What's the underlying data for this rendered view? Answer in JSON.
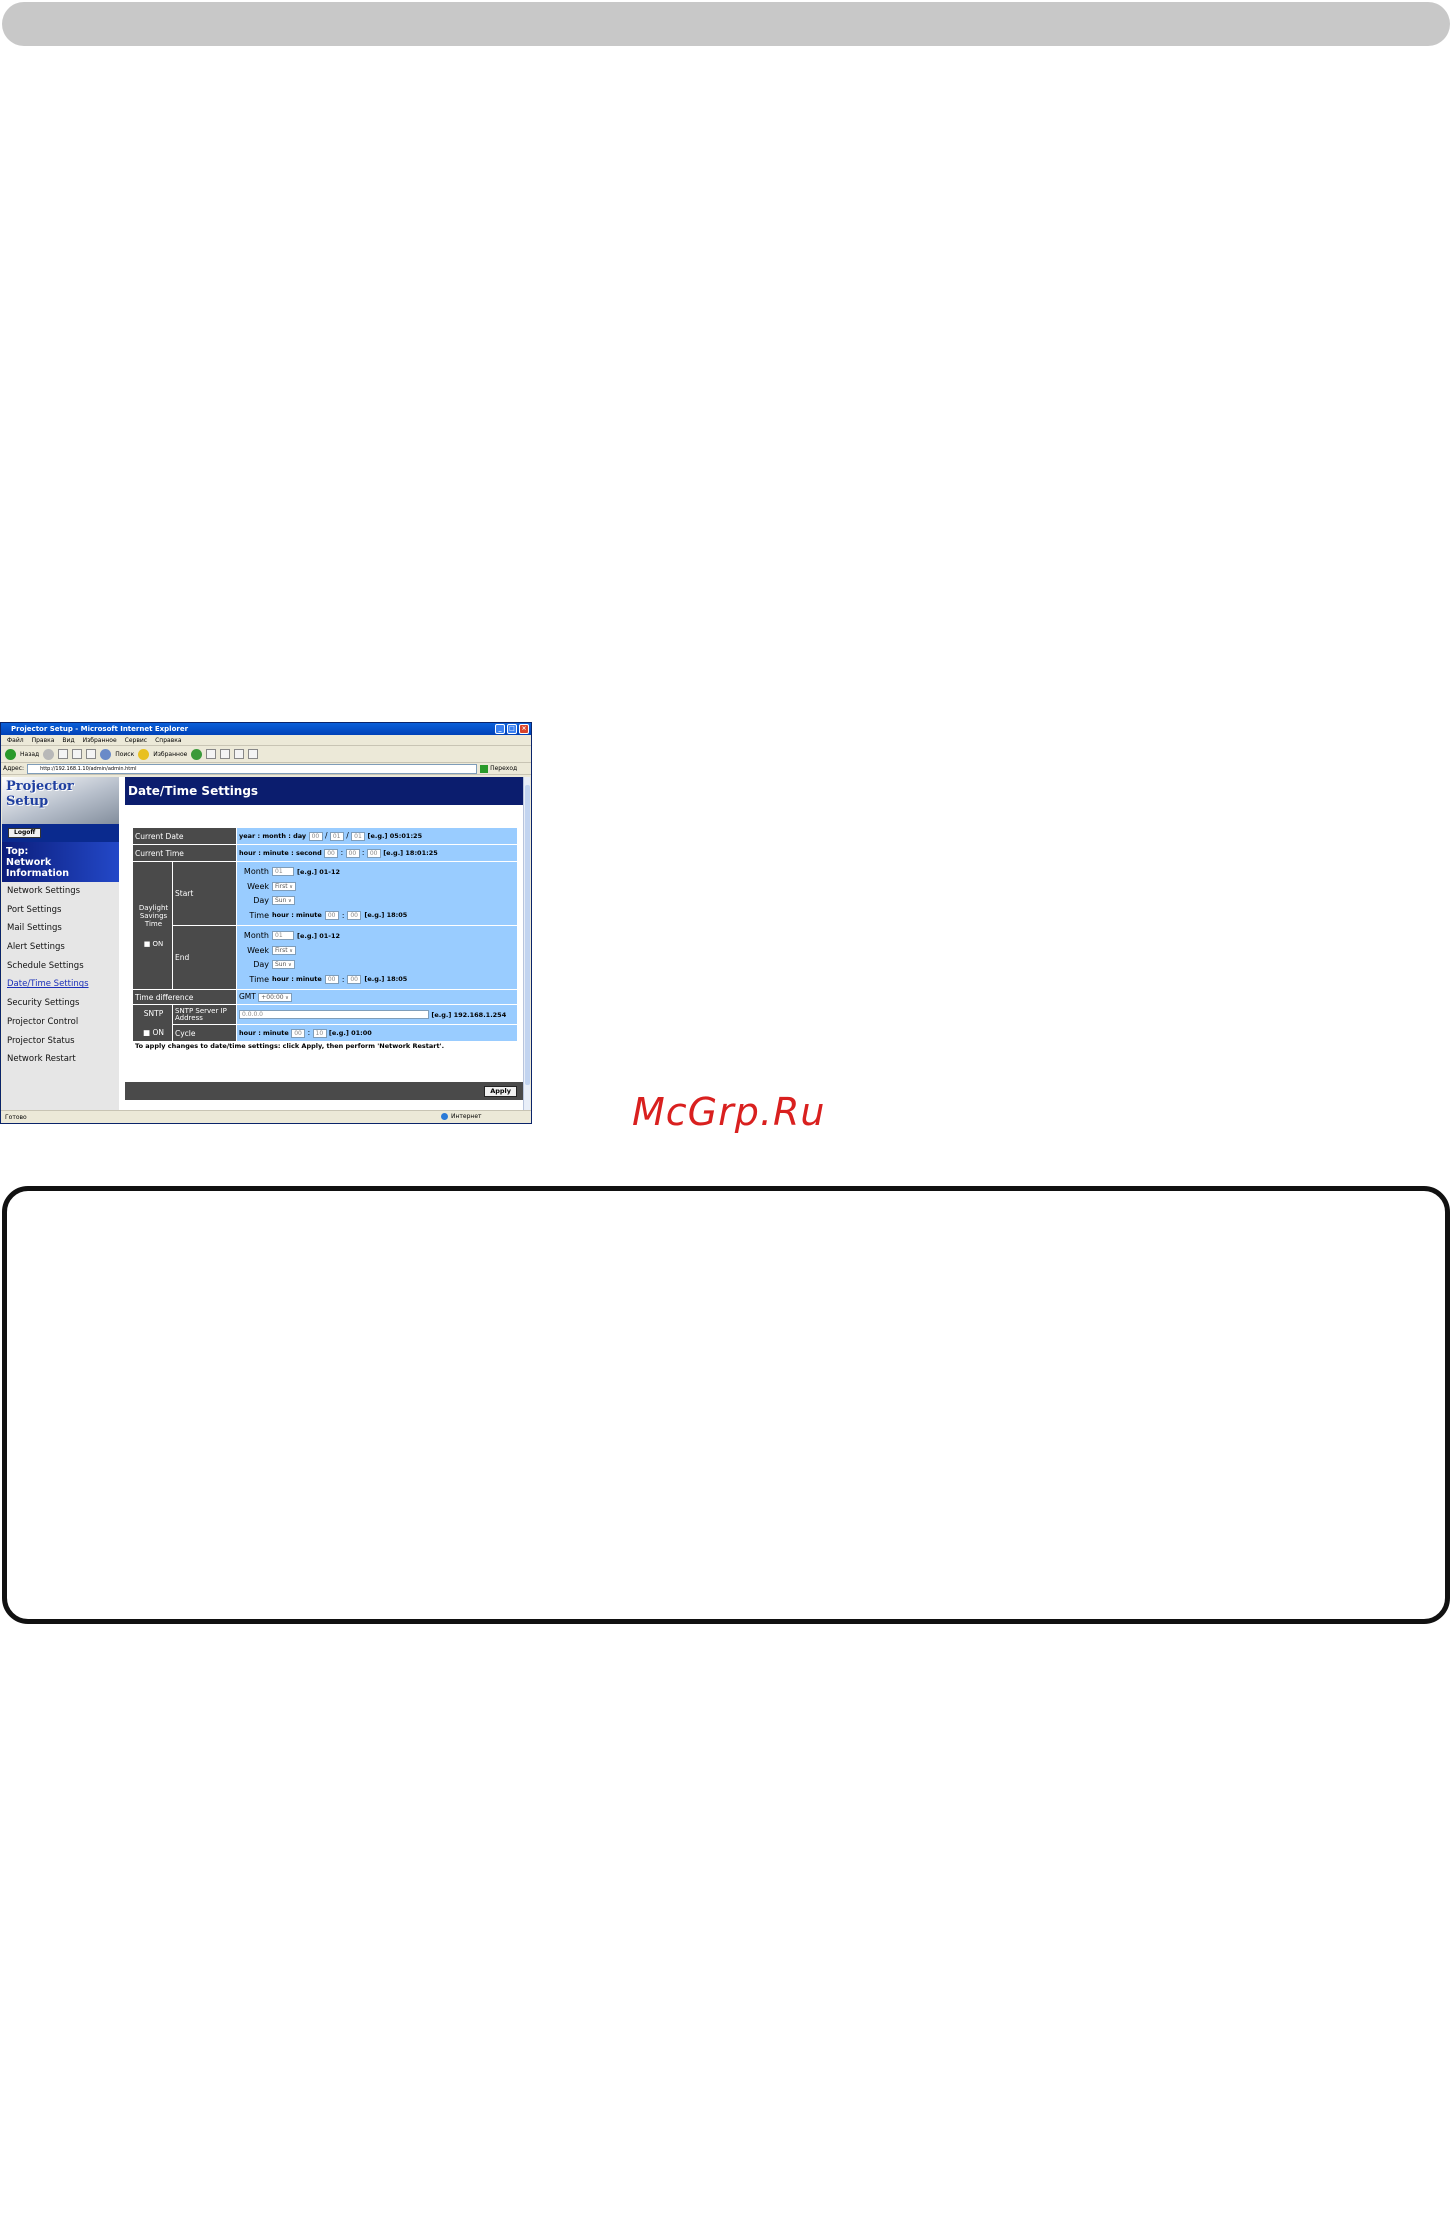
{
  "watermark": "McGrp.Ru",
  "window": {
    "title": "Projector Setup - Microsoft Internet Explorer",
    "menu": [
      "Файл",
      "Правка",
      "Вид",
      "Избранное",
      "Сервис",
      "Справка"
    ],
    "toolbar": {
      "back": "Назад",
      "search": "Поиск",
      "favorites": "Избранное"
    },
    "address_label": "Адрес:",
    "address_value": "http://192.168.1.10/admin/admin.html",
    "go_label": "Переход",
    "status_text": "Готово",
    "zone_text": "Интернет"
  },
  "sidebar": {
    "logo": "Projector Setup",
    "logoff": "Logoff",
    "top_title_1": "Top:",
    "top_title_2": "Network",
    "top_title_3": "Information",
    "items": [
      "Network Settings",
      "Port Settings",
      "Mail Settings",
      "Alert Settings",
      "Schedule Settings",
      "Date/Time Settings",
      "Security Settings",
      "Projector Control",
      "Projector Status",
      "Network Restart"
    ]
  },
  "main": {
    "title": "Date/Time Settings",
    "current_date_label": "Current Date",
    "current_date_fmt": "year : month : day",
    "current_date_values": [
      "00",
      "01",
      "01"
    ],
    "current_date_eg": "[e.g.] 05:01:25",
    "current_time_label": "Current Time",
    "current_time_fmt": "hour : minute : second",
    "current_time_values": [
      "00",
      "00",
      "00"
    ],
    "current_time_eg": "[e.g.] 18:01:25",
    "dst_label": "Daylight Savings Time",
    "dst_on": "■ ON",
    "start_label": "Start",
    "end_label": "End",
    "month_label": "Month",
    "week_label": "Week",
    "day_label": "Day",
    "time_label": "Time",
    "start_month": "01",
    "month_eg": "[e.g.] 01-12",
    "start_week": "First",
    "start_day": "Sun",
    "time_fmt": "hour : minute",
    "start_time_values": [
      "00",
      "00"
    ],
    "time_eg": "[e.g.] 18:05",
    "end_month": "01",
    "end_week": "First",
    "end_day": "Sun",
    "end_time_values": [
      "00",
      "00"
    ],
    "time_diff_label": "Time difference",
    "gmt": "GMT",
    "gmt_value": "+00:00",
    "sntp_label": "SNTP",
    "sntp_on": "■ ON",
    "sntp_server_label": "SNTP Server IP Address",
    "sntp_server_value": "0.0.0.0",
    "sntp_server_eg": "[e.g.] 192.168.1.254",
    "cycle_label": "Cycle",
    "cycle_fmt": "hour : minute",
    "cycle_values": [
      "00",
      "10"
    ],
    "cycle_eg": "[e.g.] 01:00",
    "note": "To apply changes to date/time settings: click Apply, then perform 'Network Restart'.",
    "apply": "Apply"
  }
}
